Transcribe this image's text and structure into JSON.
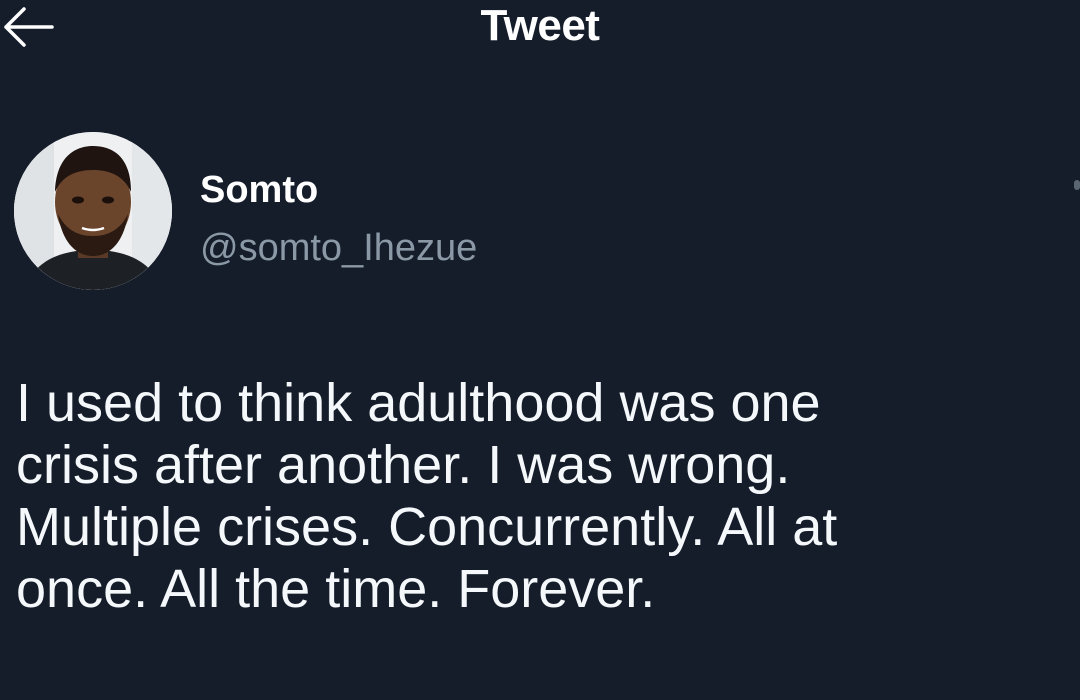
{
  "header": {
    "title": "Tweet",
    "back_icon": "arrow-left-icon"
  },
  "author": {
    "display_name": "Somto",
    "handle": "@somto_Ihezue"
  },
  "tweet": {
    "text": "I used to think adulthood was one\ncrisis after another. I was wrong.\nMultiple crises. Concurrently. All at\nonce. All the time. Forever."
  },
  "colors": {
    "background": "#151d2b",
    "text": "#ffffff",
    "secondary_text": "#8b98a5"
  }
}
